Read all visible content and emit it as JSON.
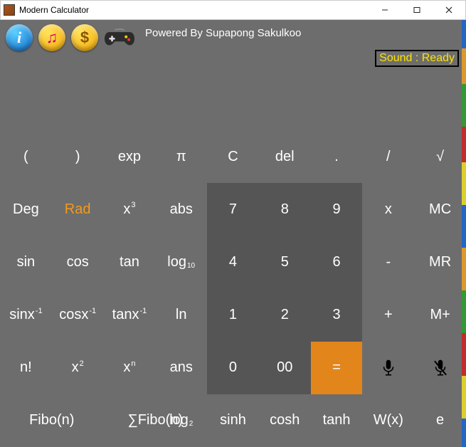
{
  "window": {
    "title": "Modern Calculator"
  },
  "header": {
    "credit": "Powered By Supapong Sakulkoo",
    "sound_badge": "Sound : Ready"
  },
  "keys": {
    "lparen": "(",
    "rparen": ")",
    "exp": "exp",
    "pi": "π",
    "clear": "C",
    "del": "del",
    "dot": ".",
    "div": "/",
    "sqrt": "√",
    "deg": "Deg",
    "rad": "Rad",
    "x3_base": "x",
    "x3_sup": "3",
    "abs": "abs",
    "d7": "7",
    "d8": "8",
    "d9": "9",
    "mul": "x",
    "mc": "MC",
    "sin": "sin",
    "cos": "cos",
    "tan": "tan",
    "log10_base": "log",
    "log10_sub": "10",
    "d4": "4",
    "d5": "5",
    "d6": "6",
    "sub": "-",
    "mr": "MR",
    "asin_base": "sinx",
    "asin_sup": "-1",
    "acos_base": "cosx",
    "acos_sup": "-1",
    "atan_base": "tanx",
    "atan_sup": "-1",
    "ln": "ln",
    "d1": "1",
    "d2": "2",
    "d3": "3",
    "add": "+",
    "mplus": "M+",
    "fact": "n!",
    "x2_base": "x",
    "x2_sup": "2",
    "xn_base": "x",
    "xn_sup": "n",
    "ans": "ans",
    "d0": "0",
    "d00": "00",
    "eq": "=",
    "fibo": "Fibo(n)",
    "sumfibo": "∑Fibo(n)",
    "log2_base": "log",
    "log2_sub": "2",
    "sinh": "sinh",
    "cosh": "cosh",
    "tanh": "tanh",
    "wx": "W(x)",
    "e": "e"
  }
}
